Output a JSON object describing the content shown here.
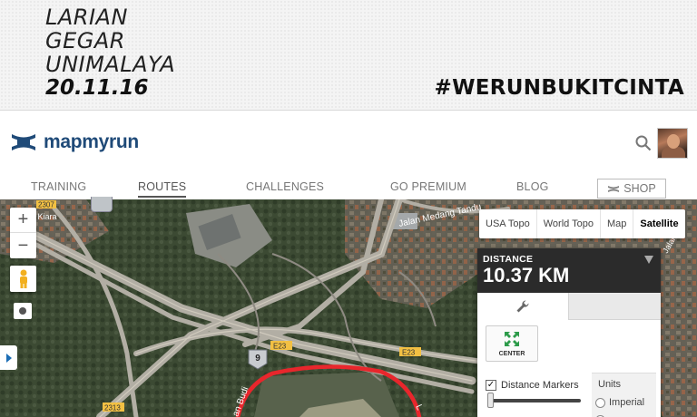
{
  "banner": {
    "event_line1": "LARIAN",
    "event_line2": "GEGAR",
    "event_line3": "UNIMALAYA",
    "event_date": "20.11.16",
    "hashtag": "#WERUNBUKITCINTA"
  },
  "header": {
    "logo_text": "mapmyrun",
    "brand_color": "#1f4a78",
    "nav": {
      "training": "TRAINING",
      "routes": "ROUTES",
      "challenges": "CHALLENGES",
      "go_premium": "GO PREMIUM",
      "blog": "BLOG",
      "shop": "SHOP"
    },
    "active_nav": "ROUTES",
    "icons": {
      "search": "search-icon",
      "avatar": "avatar",
      "logo": "under-armour-logo-icon"
    }
  },
  "map": {
    "zoom_in": "+",
    "zoom_out": "−",
    "map_types": {
      "usa_topo": "USA Topo",
      "world_topo": "World Topo",
      "map": "Map",
      "satellite": "Satellite"
    },
    "selected_map_type": "Satellite",
    "labels": {
      "kiara_code": "2307",
      "kiara": "kit Kiara",
      "medang": "Jalan Medang Tandu",
      "jalan_right": "Jalan",
      "e23_a": "E23",
      "e23_b": "E23",
      "code_2313": "2313",
      "route_number": "9",
      "budi": "an Budi",
      "road_right": "L"
    },
    "route_color": "#e8262c"
  },
  "panel": {
    "distance_label": "DISTANCE",
    "distance_value": "10.37 KM",
    "center_label": "CENTER",
    "distance_markers_label": "Distance Markers",
    "distance_markers_checked": "✓",
    "units_title": "Units",
    "units_imperial": "Imperial",
    "icons": {
      "settings": "wrench-icon",
      "center": "center-arrows-icon",
      "collapse": "caret-down-icon"
    }
  }
}
